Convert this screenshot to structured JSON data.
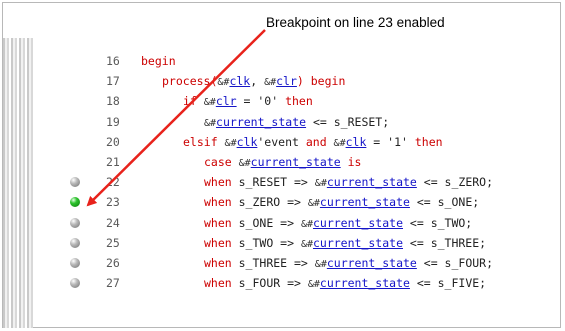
{
  "callout": {
    "text": "Breakpoint on line 23 enabled"
  },
  "colors": {
    "keyword": "#cc0000",
    "signal_link": "#1515c8",
    "arrow": "#e8221b",
    "breakpoint_enabled": "#2ec42e",
    "breakpoint_disabled": "#9a9a9a"
  },
  "lines": [
    {
      "num": "16",
      "indent": 0,
      "breakpoint": "none",
      "tokens": [
        {
          "t": "begin",
          "c": "kw"
        }
      ]
    },
    {
      "num": "17",
      "indent": 3,
      "breakpoint": "none",
      "tokens": [
        {
          "t": "process(",
          "c": "kw"
        },
        {
          "t": "&#",
          "c": "glass"
        },
        {
          "t": "clk",
          "c": "sig"
        },
        {
          "t": ", ",
          "c": "pl"
        },
        {
          "t": "&#",
          "c": "glass"
        },
        {
          "t": "clr",
          "c": "sig"
        },
        {
          "t": ") begin",
          "c": "kw"
        }
      ]
    },
    {
      "num": "18",
      "indent": 6,
      "breakpoint": "none",
      "tokens": [
        {
          "t": "if ",
          "c": "kw"
        },
        {
          "t": "&#",
          "c": "glass"
        },
        {
          "t": "clr",
          "c": "sig"
        },
        {
          "t": " = '0' ",
          "c": "pl"
        },
        {
          "t": "then",
          "c": "kw"
        }
      ]
    },
    {
      "num": "19",
      "indent": 9,
      "breakpoint": "none",
      "tokens": [
        {
          "t": "&#",
          "c": "glass"
        },
        {
          "t": "current_state",
          "c": "sig"
        },
        {
          "t": " <= s_RESET;",
          "c": "pl"
        }
      ]
    },
    {
      "num": "20",
      "indent": 6,
      "breakpoint": "none",
      "tokens": [
        {
          "t": "elsif ",
          "c": "kw"
        },
        {
          "t": "&#",
          "c": "glass"
        },
        {
          "t": "clk",
          "c": "sig"
        },
        {
          "t": "'event ",
          "c": "pl"
        },
        {
          "t": "and ",
          "c": "kw"
        },
        {
          "t": "&#",
          "c": "glass"
        },
        {
          "t": "clk",
          "c": "sig"
        },
        {
          "t": " = '1' ",
          "c": "pl"
        },
        {
          "t": "then",
          "c": "kw"
        }
      ]
    },
    {
      "num": "21",
      "indent": 9,
      "breakpoint": "none",
      "tokens": [
        {
          "t": "case ",
          "c": "kw"
        },
        {
          "t": "&#",
          "c": "glass"
        },
        {
          "t": "current_state",
          "c": "sig"
        },
        {
          "t": " is",
          "c": "kw"
        }
      ]
    },
    {
      "num": "22",
      "indent": 9,
      "breakpoint": "disabled",
      "tokens": [
        {
          "t": "when ",
          "c": "kw"
        },
        {
          "t": "s_RESET => ",
          "c": "pl"
        },
        {
          "t": "&#",
          "c": "glass"
        },
        {
          "t": "current_state",
          "c": "sig"
        },
        {
          "t": " <= s_ZERO;",
          "c": "pl"
        }
      ]
    },
    {
      "num": "23",
      "indent": 9,
      "breakpoint": "enabled",
      "tokens": [
        {
          "t": "when ",
          "c": "kw"
        },
        {
          "t": "s_ZERO => ",
          "c": "pl"
        },
        {
          "t": "&#",
          "c": "glass"
        },
        {
          "t": "current_state",
          "c": "sig"
        },
        {
          "t": " <= s_ONE;",
          "c": "pl"
        }
      ]
    },
    {
      "num": "24",
      "indent": 9,
      "breakpoint": "disabled",
      "tokens": [
        {
          "t": "when ",
          "c": "kw"
        },
        {
          "t": "s_ONE => ",
          "c": "pl"
        },
        {
          "t": "&#",
          "c": "glass"
        },
        {
          "t": "current_state",
          "c": "sig"
        },
        {
          "t": " <= s_TWO;",
          "c": "pl"
        }
      ]
    },
    {
      "num": "25",
      "indent": 9,
      "breakpoint": "disabled",
      "tokens": [
        {
          "t": "when ",
          "c": "kw"
        },
        {
          "t": "s_TWO => ",
          "c": "pl"
        },
        {
          "t": "&#",
          "c": "glass"
        },
        {
          "t": "current_state",
          "c": "sig"
        },
        {
          "t": " <= s_THREE;",
          "c": "pl"
        }
      ]
    },
    {
      "num": "26",
      "indent": 9,
      "breakpoint": "disabled",
      "tokens": [
        {
          "t": "when ",
          "c": "kw"
        },
        {
          "t": "s_THREE => ",
          "c": "pl"
        },
        {
          "t": "&#",
          "c": "glass"
        },
        {
          "t": "current_state",
          "c": "sig"
        },
        {
          "t": " <= s_FOUR;",
          "c": "pl"
        }
      ]
    },
    {
      "num": "27",
      "indent": 9,
      "breakpoint": "disabled",
      "tokens": [
        {
          "t": "when ",
          "c": "kw"
        },
        {
          "t": "s_FOUR => ",
          "c": "pl"
        },
        {
          "t": "&#",
          "c": "glass"
        },
        {
          "t": "current_state",
          "c": "sig"
        },
        {
          "t": " <= s_FIVE;",
          "c": "pl"
        }
      ]
    }
  ]
}
